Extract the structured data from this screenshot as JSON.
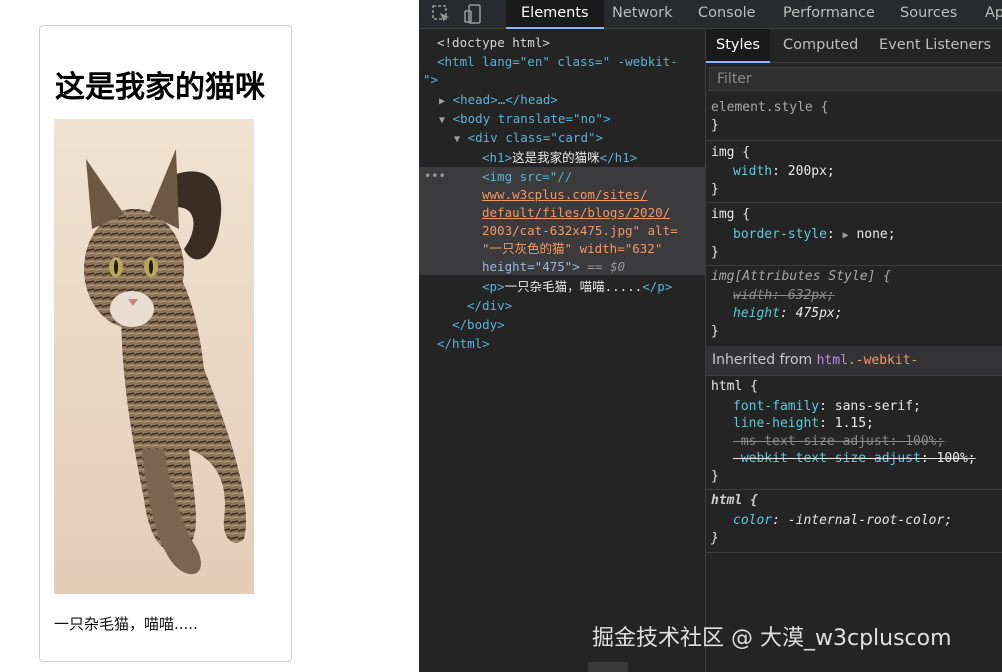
{
  "page": {
    "heading": "这是我家的猫咪",
    "caption": "一只杂毛猫，喵喵....."
  },
  "devtools": {
    "tabs": [
      "Elements",
      "Network",
      "Console",
      "Performance",
      "Sources",
      "Ap"
    ],
    "active_tab": "Elements",
    "tree": {
      "doctype": "<!doctype html>",
      "html_open_1": "<html lang=\"en\" class=\" -webkit-",
      "html_open_2": "\">",
      "head": "<head>…</head>",
      "body": "<body translate=\"no\">",
      "div": "<div class=\"card\">",
      "h1_text": "这是我家的猫咪",
      "img_line1": "<img src=\"//",
      "img_line2": "www.w3cplus.com/sites/",
      "img_line3": "default/files/blogs/2020/",
      "img_line4": "2003/cat-632x475.jpg\" alt=",
      "img_line5": "\"一只灰色的猫\" width=\"632\"",
      "img_line6": "height=\"475\">",
      "selected_marker": " == $0",
      "p_text": "一只杂毛猫，喵喵.....",
      "div_close": "</div>",
      "body_close": "</body>",
      "html_close": "</html>"
    },
    "styles": {
      "subtabs": [
        "Styles",
        "Computed",
        "Event Listeners"
      ],
      "filter_placeholder": "Filter",
      "element_style": "element.style {",
      "rules": [
        {
          "selector": "img {",
          "decls": [
            {
              "prop": "width",
              "val": "200px;"
            }
          ]
        },
        {
          "selector": "img {",
          "decls": [
            {
              "prop": "border-style",
              "val": "none;"
            }
          ]
        },
        {
          "selector": "img[Attributes Style] {",
          "decls": [
            {
              "prop": "width",
              "val": "632px;"
            },
            {
              "prop": "height",
              "val": "475px;"
            }
          ]
        }
      ],
      "inherited_label": "Inherited from ",
      "inherited_tag": "html",
      "inherited_class": ".-webkit-",
      "html_rule": {
        "selector": "html {",
        "decls": [
          {
            "prop": "font-family",
            "val": "sans-serif;"
          },
          {
            "prop": "line-height",
            "val": "1.15;"
          },
          {
            "prop": "-ms-text-size-adjust",
            "val": "100%;"
          },
          {
            "prop": "-webkit-text-size-adjust",
            "val": "100%;"
          }
        ]
      },
      "html_ua_rule": {
        "selector": "html {",
        "decls": [
          {
            "prop": "color",
            "val": "-internal-root-color;"
          }
        ]
      },
      "close_brace": "}"
    }
  },
  "watermark": "掘金技术社区 @ 大漠_w3cpluscom",
  "colors": {
    "devtools_bg": "#242424",
    "tag": "#5db0d7",
    "attr_value": "#f29766",
    "css_prop": "#5fc9d9",
    "active_tab_underline": "#8ab4f8"
  }
}
